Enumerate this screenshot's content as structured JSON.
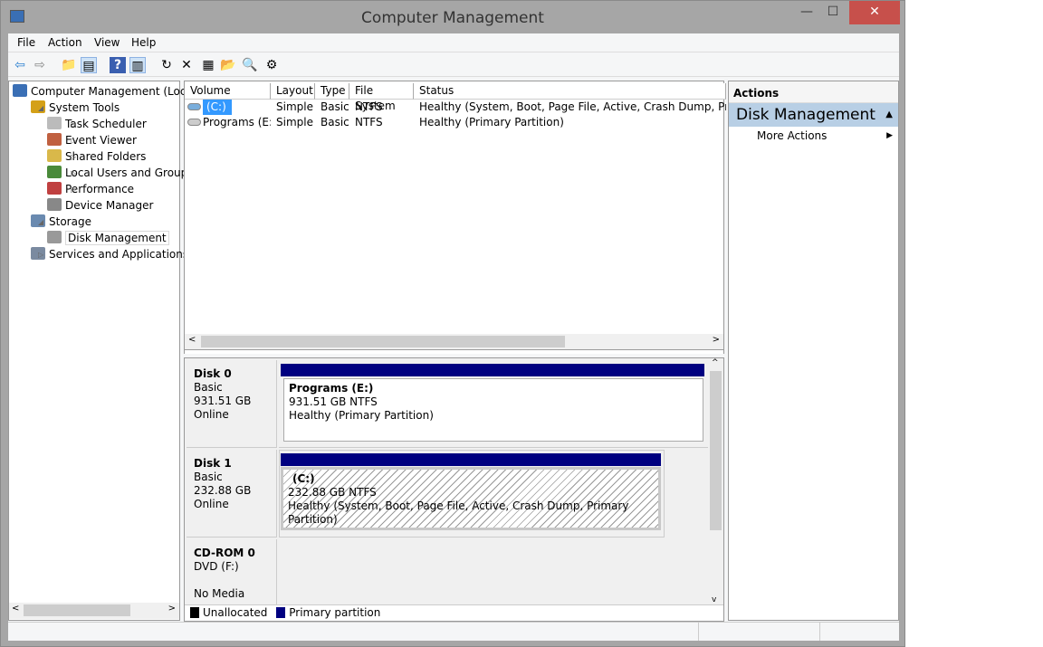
{
  "window": {
    "title": "Computer Management",
    "minimize": "—",
    "maximize": "☐",
    "close": "✕"
  },
  "menu": [
    "File",
    "Action",
    "View",
    "Help"
  ],
  "toolbar": [
    {
      "icon": "back-arrow-icon",
      "g": "⇦"
    },
    {
      "icon": "forward-arrow-icon",
      "g": "⇨"
    },
    {
      "icon": "up-folder-icon",
      "g": "📁"
    },
    {
      "icon": "show-hide-tree-icon",
      "g": "▤"
    },
    {
      "icon": "help-icon",
      "g": "?"
    },
    {
      "icon": "show-hide-action-pane-icon",
      "g": "▥"
    },
    {
      "icon": "refresh-icon",
      "g": "↻"
    },
    {
      "icon": "delete-icon",
      "g": "✕"
    },
    {
      "icon": "properties-icon",
      "g": "▦"
    },
    {
      "icon": "open-folder-icon",
      "g": "📂"
    },
    {
      "icon": "search-icon",
      "g": "🔍"
    },
    {
      "icon": "settings-icon",
      "g": "⚙"
    }
  ],
  "tree": [
    {
      "label": "Computer Management (Local",
      "level": 0,
      "exp": ""
    },
    {
      "label": "System Tools",
      "level": 1,
      "exp": "◢"
    },
    {
      "label": "Task Scheduler",
      "level": 2,
      "exp": "▷"
    },
    {
      "label": "Event Viewer",
      "level": 2,
      "exp": "▷"
    },
    {
      "label": "Shared Folders",
      "level": 2,
      "exp": "▷"
    },
    {
      "label": "Local Users and Groups",
      "level": 2,
      "exp": "▷"
    },
    {
      "label": "Performance",
      "level": 2,
      "exp": "▷"
    },
    {
      "label": "Device Manager",
      "level": 2,
      "exp": ""
    },
    {
      "label": "Storage",
      "level": 1,
      "exp": "◢"
    },
    {
      "label": "Disk Management",
      "level": 2,
      "exp": "",
      "selected": true
    },
    {
      "label": "Services and Applications",
      "level": 1,
      "exp": "▷"
    }
  ],
  "volumes": {
    "columns": [
      "Volume",
      "Layout",
      "Type",
      "File System",
      "Status"
    ],
    "rows": [
      [
        "(C:)",
        "Simple",
        "Basic",
        "NTFS",
        "Healthy (System, Boot, Page File, Active, Crash Dump, Primary Partition)"
      ],
      [
        "Programs (E:)",
        "Simple",
        "Basic",
        "NTFS",
        "Healthy (Primary Partition)"
      ]
    ]
  },
  "disks": [
    {
      "name": "Disk 0",
      "type": "Basic",
      "size": "931.51 GB",
      "state": "Online",
      "part_name": "Programs  (E:)",
      "part_size": "931.51 GB NTFS",
      "part_status": "Healthy (Primary Partition)"
    },
    {
      "name": "Disk 1",
      "type": "Basic",
      "size": "232.88 GB",
      "state": "Online",
      "part_name": "(C:)",
      "part_size": "232.88 GB NTFS",
      "part_status": "Healthy (System, Boot, Page File, Active, Crash Dump, Primary Partition)"
    },
    {
      "name": "CD-ROM 0",
      "type": "DVD (F:)",
      "state": "No Media"
    }
  ],
  "legend": [
    {
      "label": "Unallocated",
      "color": "#000000"
    },
    {
      "label": "Primary partition",
      "color": "#000080"
    }
  ],
  "actions": {
    "header": "Actions",
    "section": "Disk Management",
    "item": "More Actions"
  },
  "colors": {
    "partition_bar": "#000080",
    "selection": "#3399ff",
    "close_button": "#c7504b",
    "actions_section": "#b8cfe5"
  }
}
